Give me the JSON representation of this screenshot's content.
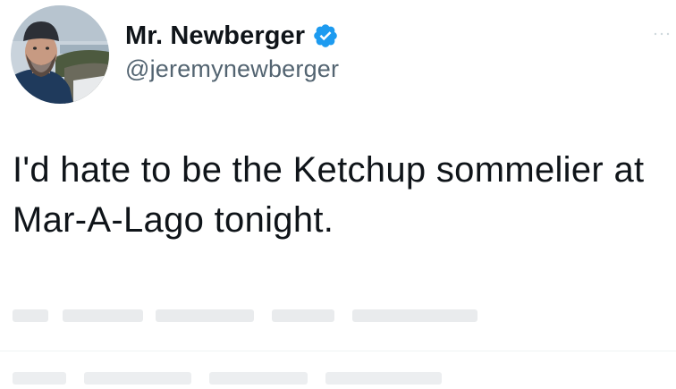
{
  "author": {
    "display_name": "Mr. Newberger",
    "handle": "@jeremynewberger",
    "verified": true,
    "avatar_icon": "profile-photo",
    "verified_icon": "verified-badge-icon",
    "verified_color": "#1d9bf0"
  },
  "tweet": {
    "text": "I'd hate to be the Ketchup sommelier at Mar-A-Lago tonight."
  },
  "colors": {
    "name": "#0f1419",
    "handle": "#536471",
    "text": "#0f1419"
  }
}
